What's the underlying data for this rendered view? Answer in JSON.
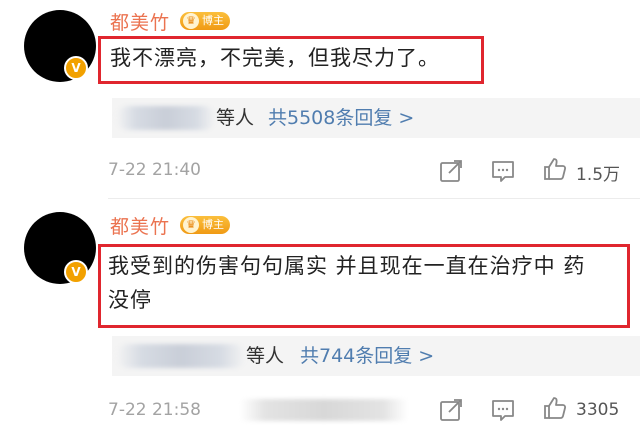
{
  "comments": [
    {
      "username": "都美竹",
      "badge_label": "博主",
      "verified_mark": "V",
      "text": "我不漂亮，不完美，但我尽力了。",
      "reply_others": "等人",
      "reply_count": "共5508条回复 >",
      "timestamp": "7-22 21:40",
      "like_count": "1.5万",
      "icons": [
        "share-icon",
        "comment-icon",
        "like-icon"
      ]
    },
    {
      "username": "都美竹",
      "badge_label": "博主",
      "verified_mark": "V",
      "text_line1": "我受到的伤害句句属实 并且现在一直在治疗中 药",
      "text_line2": "没停",
      "reply_others": "等人",
      "reply_count": "共744条回复 >",
      "timestamp": "7-22 21:58",
      "like_count": "3305",
      "icons": [
        "share-icon",
        "comment-icon",
        "like-icon"
      ]
    }
  ],
  "colors": {
    "username": "#eb7350",
    "highlight_box": "#e0262e",
    "reply_link": "#507daf",
    "badge": "#f09a14"
  }
}
